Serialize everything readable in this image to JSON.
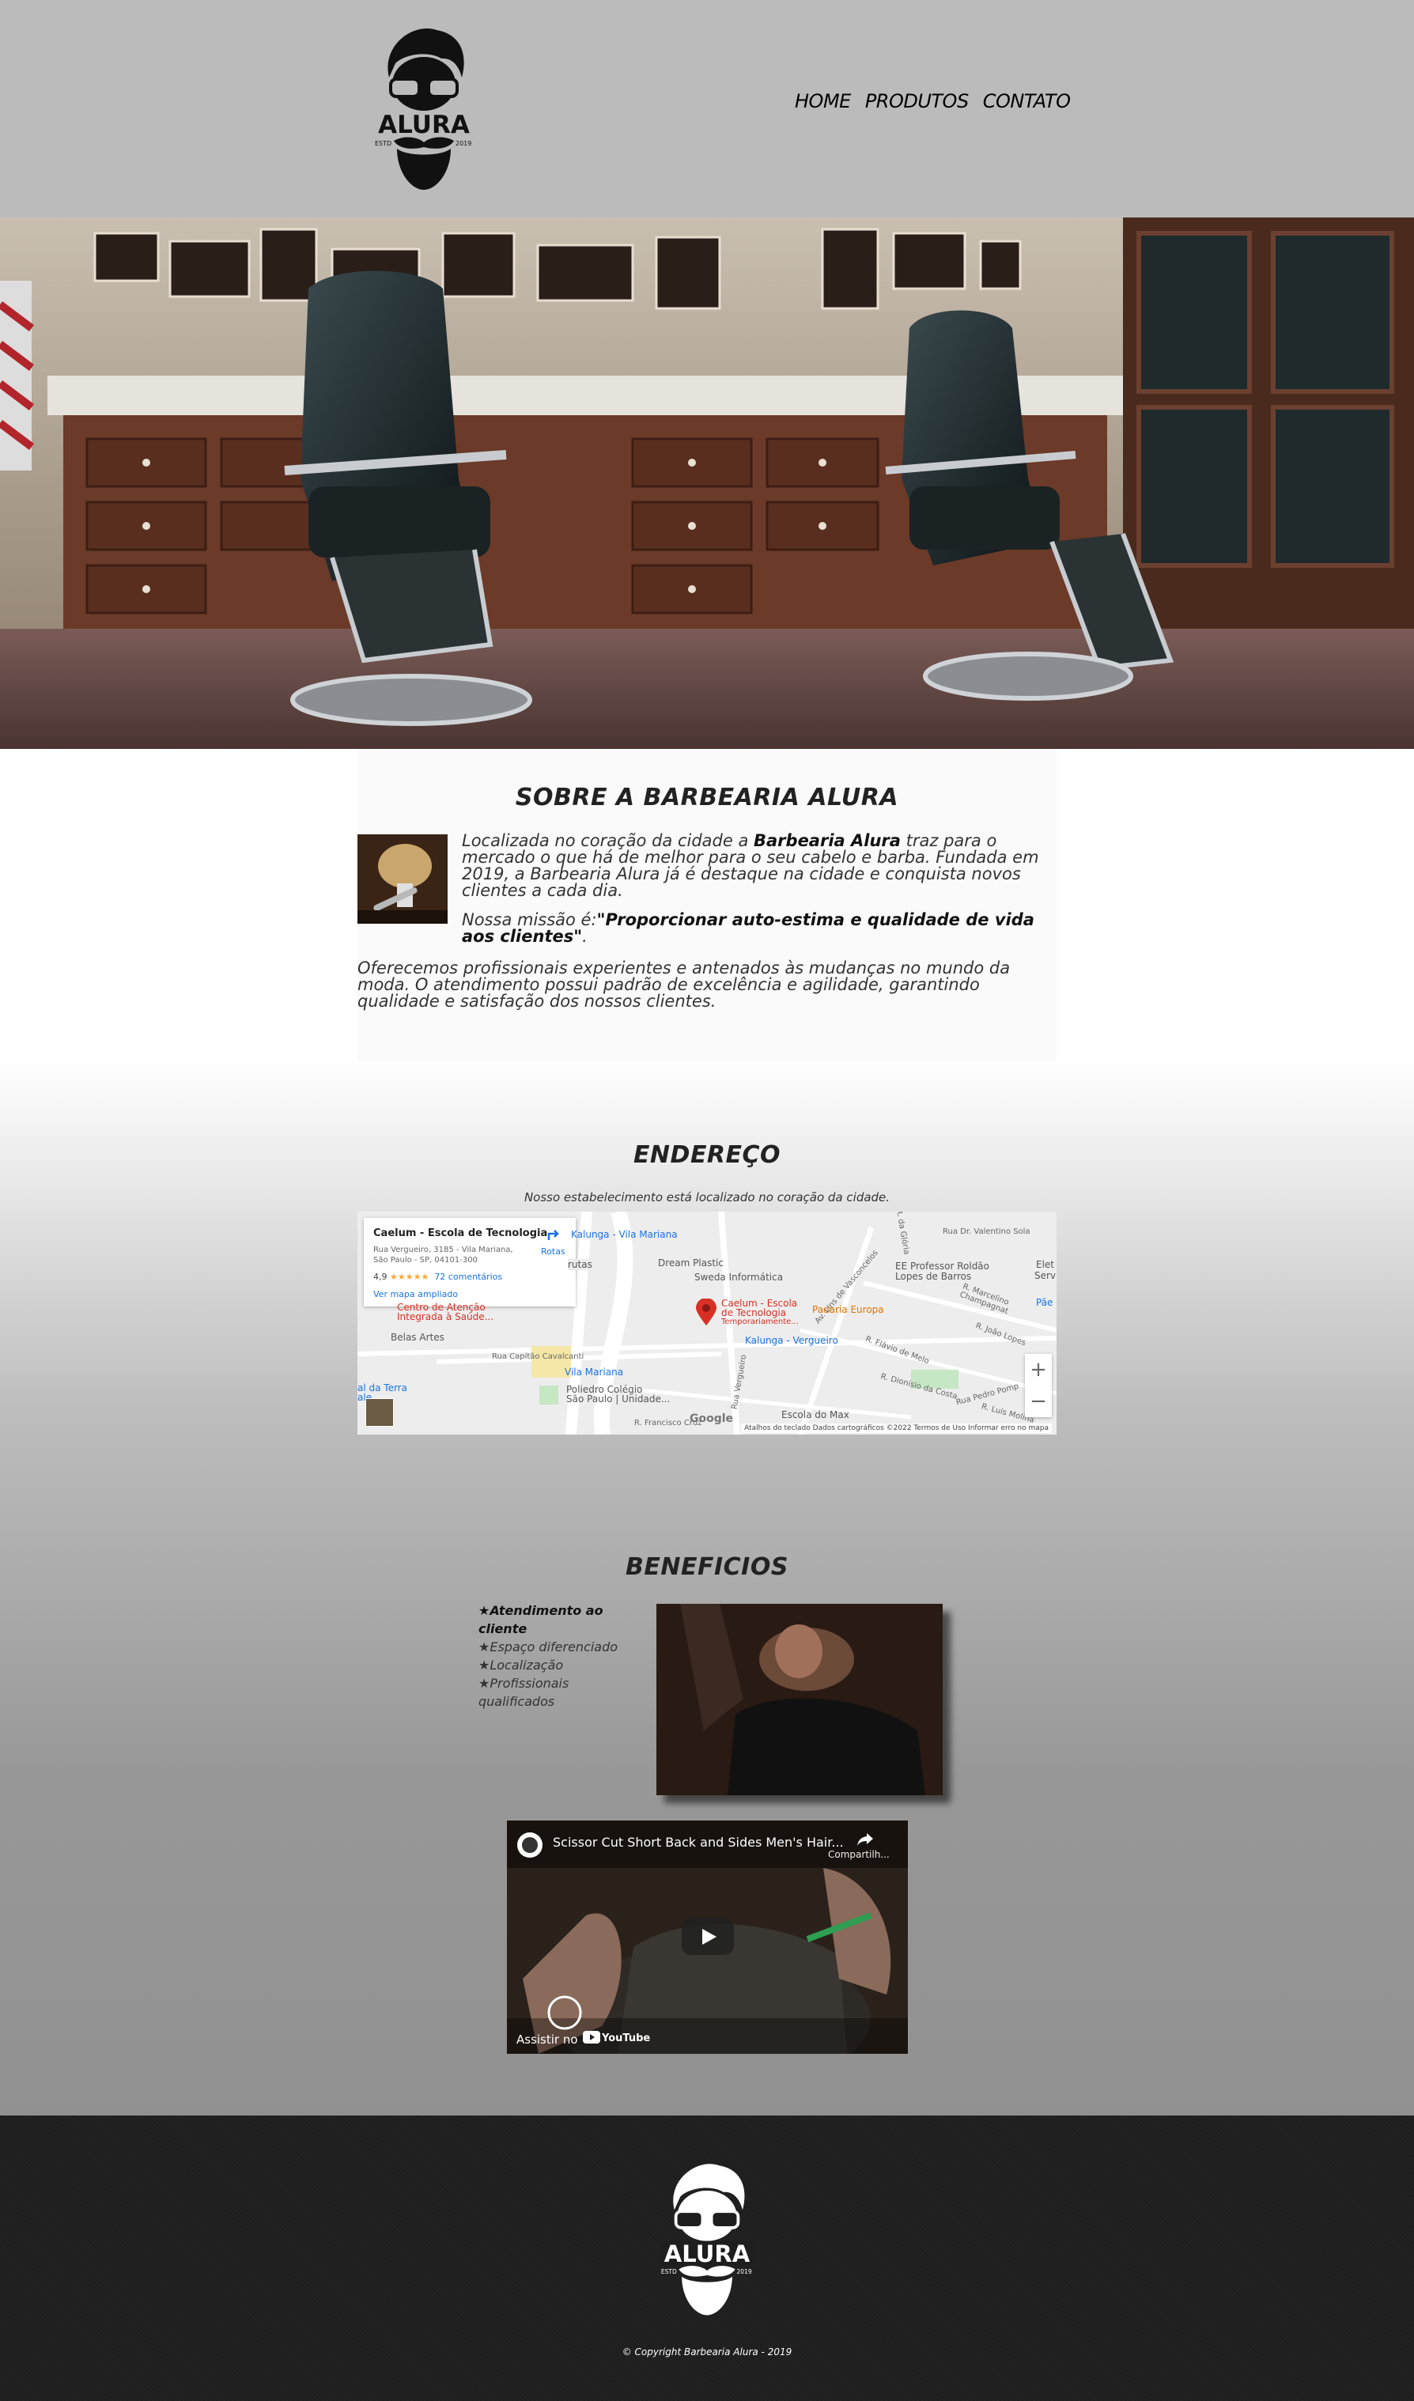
{
  "header": {
    "logo": {
      "text": "ALURA",
      "est": "ESTD",
      "year": "2019",
      "icon": "bearded-man-logo"
    },
    "nav": [
      {
        "label": "HOME"
      },
      {
        "label": "PRODUTOS"
      },
      {
        "label": "CONTATO"
      }
    ]
  },
  "hero": {
    "icon": "barbershop-photo"
  },
  "about": {
    "title": "SOBRE A BARBEARIA ALURA",
    "p1_before": "Localizada no coração da cidade a ",
    "p1_strong": "Barbearia Alura",
    "p1_after": " traz para o mercado o que há de melhor para o seu cabelo e barba. Fundada em 2019, a Barbearia Alura já é destaque na cidade e conquista novos clientes a cada dia.",
    "p2_before": "Nossa missão é:",
    "p2_strong": "\"Proporcionar auto-estima e qualidade de vida aos clientes\"",
    "p2_after": ".",
    "p3": "Oferecemos profissionais experientes e antenados às mudanças no mundo da moda. O atendimento possui padrão de excelência e agilidade, garantindo qualidade e satisfação dos nossos clientes."
  },
  "address": {
    "title": "ENDEREÇO",
    "subtitle": "Nosso estabelecimento está localizado no coração da cidade.",
    "map": {
      "place_name": "Caelum - Escola de Tecnologia",
      "place_address": "Rua Vergueiro, 3185 - Vila Mariana, São Paulo - SP, 04101-300",
      "rating": "4,9",
      "stars": "★★★★★",
      "reviews": "72 comentários",
      "bigger_map": "Ver mapa ampliado",
      "routes": "Rotas",
      "pin_label_1": "Caelum - Escola",
      "pin_label_2": "de Tecnologia",
      "pin_label_3": "Temporariamente...",
      "labels": [
        "Kalunga - Vila Mariana",
        "Dream Plastic",
        "Sweda Informática",
        "EE Professor Roldão",
        "Lopes de Barros",
        "Padaria Europa",
        "Kalunga - Vergueiro",
        "Centro de Atenção",
        "Integrada à Saúde...",
        "Belas Artes",
        "Vila Mariana",
        "Poliedro Colégio",
        "São Paulo | Unidade...",
        "Escola do Max",
        "R. Francisco Cruz",
        "Rua Capitão Cavalcanti",
        "Av. Lins de Vasconcelos",
        "R. Marcelino Champagnat",
        "R. João Lopes",
        "R. Flávio de Melo",
        "R. Dionísio da Costa",
        "Rua Pedro Pomp",
        "R. Luís Molina",
        "Rua Dr. Valentino Sola",
        "R. da Glória",
        "Rua Vergueiro",
        "Pãe",
        "Elet",
        "Servic",
        "rutas",
        "al da Terra",
        "ale..."
      ],
      "zoom_in": "+",
      "zoom_out": "−",
      "google": "Google",
      "footer": "Atalhos do teclado   Dados cartográficos ©2022   Termos de Uso   Informar erro no mapa"
    }
  },
  "benefits": {
    "title": "BENEFICIOS",
    "items": [
      "★Atendimento ao cliente",
      "★Espaço diferenciado",
      "★Localização",
      "★Profissionais qualificados"
    ],
    "image_icon": "barber-shaving-photo"
  },
  "video": {
    "title": "Scissor Cut Short Back and Sides Men's Hair...",
    "share": "Compartilh...",
    "watch_on": "Assistir no",
    "youtube": "YouTube"
  },
  "footer": {
    "logo": {
      "text": "ALURA",
      "est": "ESTD",
      "year": "2019"
    },
    "copyright": "© Copyright Barbearia Alura - 2019"
  },
  "colors": {
    "header_bg": "#bbbbbb",
    "footer_bg": "#1e1e1e",
    "map_pin": "#d93025",
    "link_blue": "#1a73e8"
  }
}
